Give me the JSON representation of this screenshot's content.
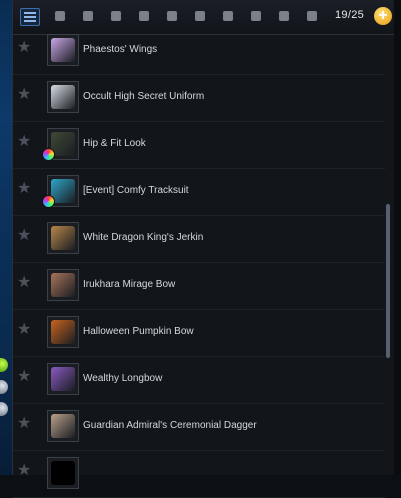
{
  "toolbar": {
    "count": "19/25",
    "filters": [
      "menu-icon",
      "helmet-icon",
      "armor-icon",
      "wings-icon",
      "sword-icon",
      "shield-icon",
      "hand-icon",
      "gloves-icon",
      "accessory-icon",
      "bow-icon",
      "ring-icon"
    ]
  },
  "items": [
    {
      "name": "Phaestos' Wings",
      "icon": "wings-icon",
      "dye": false,
      "color": "#c9a6e6"
    },
    {
      "name": "Occult High Secret Uniform",
      "icon": "uniform-icon",
      "dye": false,
      "color": "#d7dde6"
    },
    {
      "name": "Hip & Fit Look",
      "icon": "costume-icon",
      "dye": true,
      "color": "#3f4a36"
    },
    {
      "name": "[Event] Comfy Tracksuit",
      "icon": "tracksuit-icon",
      "dye": true,
      "color": "#2fa6c9"
    },
    {
      "name": "White Dragon King's Jerkin",
      "icon": "jerkin-icon",
      "dye": false,
      "color": "#b8874a"
    },
    {
      "name": "Irukhara Mirage Bow",
      "icon": "bow-icon",
      "dye": false,
      "color": "#a9745a"
    },
    {
      "name": "Halloween Pumpkin Bow",
      "icon": "bow-icon",
      "dye": false,
      "color": "#c8641f"
    },
    {
      "name": "Wealthy Longbow",
      "icon": "longbow-icon",
      "dye": false,
      "color": "#8a5ac2"
    },
    {
      "name": "Guardian Admiral's Ceremonial Dagger",
      "icon": "dagger-icon",
      "dye": false,
      "color": "#b9a08a"
    },
    {
      "name": "",
      "icon": "empty-slot-icon",
      "dye": false,
      "color": "#000000"
    }
  ]
}
